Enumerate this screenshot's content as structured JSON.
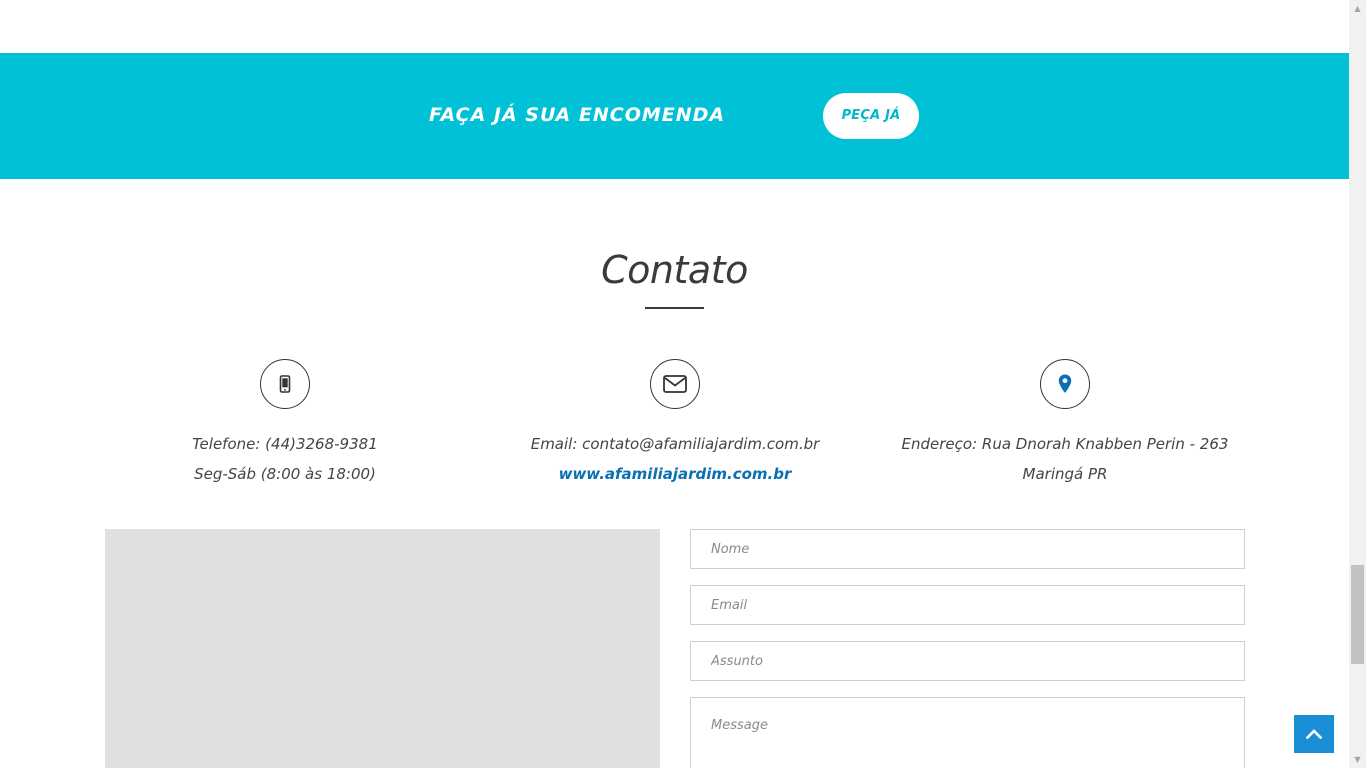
{
  "banner": {
    "title": "FAÇA JÁ SUA ENCOMENDA",
    "button_label": "PEÇA JÁ",
    "background_color": "#00c1d6"
  },
  "contact": {
    "title": "Contato",
    "phone": {
      "icon": "mobile-phone-icon",
      "line1": "Telefone: (44)3268-9381",
      "line2": "Seg-Sáb (8:00 às 18:00)"
    },
    "email": {
      "icon": "envelope-icon",
      "line1": "Email: contato@afamiliajardim.com.br",
      "website": "www.afamiliajardim.com.br"
    },
    "address": {
      "icon": "map-pin-icon",
      "line1": "Endereço: Rua Dnorah Knabben Perin - 263",
      "line2": "Maringá PR"
    }
  },
  "form": {
    "name_placeholder": "Nome",
    "email_placeholder": "Email",
    "subject_placeholder": "Assunto",
    "message_placeholder": "Message"
  },
  "back_to_top": {
    "icon": "chevron-up-icon",
    "color": "#1a8fd8"
  },
  "link_color": "#0a6fb3"
}
